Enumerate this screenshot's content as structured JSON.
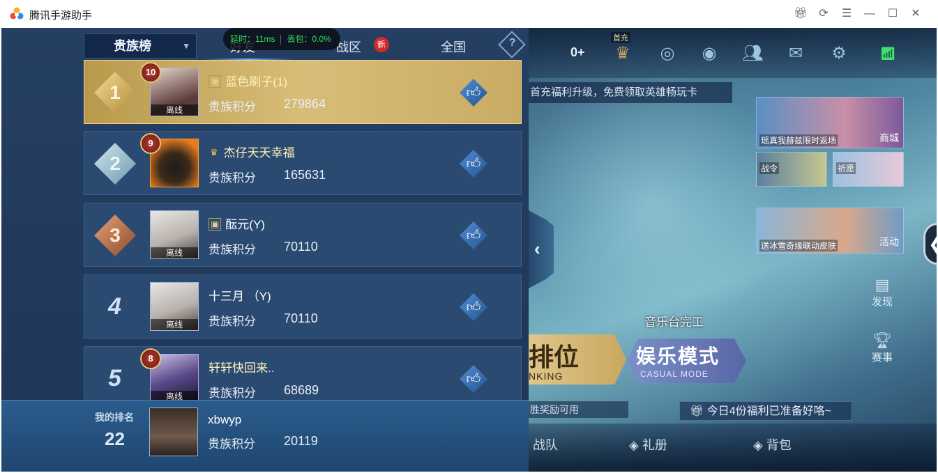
{
  "window": {
    "title": "腾讯手游助手"
  },
  "overlay": {
    "latency": "延时：11ms",
    "packet_loss": "丢包：0.0%"
  },
  "leaderboard": {
    "dropdown_label": "贵族榜",
    "tabs": [
      "好友",
      "战区",
      "全国"
    ],
    "active_tab": "好友",
    "new_badge": "新",
    "help_label": "?",
    "offline_label": "离线",
    "score_label": "贵族积分",
    "rows": [
      {
        "rank": "1",
        "vip": "10",
        "name": "蓝色刷子(1)",
        "score": "279864",
        "offline": true,
        "tag": true
      },
      {
        "rank": "2",
        "vip": "9",
        "name": "杰仔天天幸福",
        "score": "165631",
        "offline": false,
        "tag": true
      },
      {
        "rank": "3",
        "vip": "",
        "name": "酝元(Y)",
        "score": "70110",
        "offline": true,
        "tag": true
      },
      {
        "rank": "4",
        "vip": "",
        "name": "十三月 （Y)",
        "score": "70110",
        "offline": true,
        "tag": false
      },
      {
        "rank": "5",
        "vip": "8",
        "name": "轩轩快回来..",
        "score": "68689",
        "offline": true,
        "tag": false
      }
    ],
    "me": {
      "label": "我的排名",
      "rank": "22",
      "name": "xbwyp",
      "score": "20119"
    }
  },
  "lobby": {
    "coins": "0+",
    "first_charge": "首充",
    "banner": "首充福利升级，免费领取英雄畅玩卡",
    "promo_1_caption": "瑶真我赫兹限时返场",
    "promo_1_side": "商城",
    "promo_2a": "战令",
    "promo_2b": "祈愿",
    "promo_3_caption": "送冰雪奇缘联动皮肤",
    "promo_3_side": "活动",
    "discover": "发现",
    "events": "赛事",
    "music_stage": "音乐台完工",
    "rank_mode": "排位",
    "rank_mode_en": "NKING",
    "casual_mode": "娱乐模式",
    "casual_mode_en": "CASUAL MODE",
    "win_reward": "胜奖励可用",
    "welfare": "今日4份福利已准备好咯~",
    "bottom_team": "战队",
    "bottom_gift": "礼册",
    "bottom_bag": "背包"
  }
}
